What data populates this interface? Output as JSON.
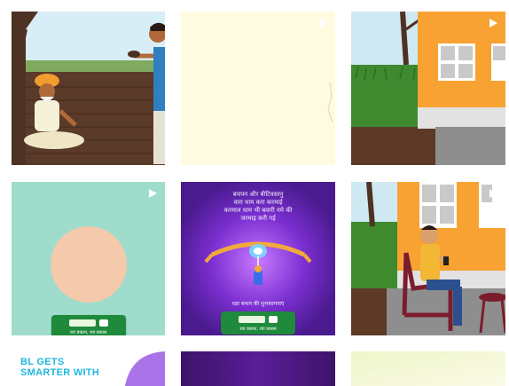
{
  "gallery": {
    "tiles": [
      {
        "id": "t1",
        "kind": "video",
        "scene": "farmer-field"
      },
      {
        "id": "t2",
        "kind": "video",
        "scene": "blank-cream"
      },
      {
        "id": "t3",
        "kind": "video",
        "scene": "orange-house"
      },
      {
        "id": "t4",
        "kind": "video",
        "scene": "peach-circle",
        "badge_caption": "रवा प्रकाश, रवा प्रकास"
      },
      {
        "id": "t5",
        "kind": "video",
        "scene": "rakhi-poster",
        "poem_lines": [
          "बचपन और बीटिवस्तनु",
          "वारा धाम करा करमाई",
          "करमाल धाम भी बवारी नमे की",
          "जरमाइ करी गई"
        ],
        "footer_text": "रक्षा बन्धन की शुभकामनाएं",
        "badge_caption": "रवा प्रकाश, रवा प्रकास"
      },
      {
        "id": "t6",
        "kind": "video",
        "scene": "man-on-chair"
      },
      {
        "id": "t7",
        "kind": "image",
        "scene": "promo",
        "promo_lines": [
          "BL GETS",
          "SMARTER WITH"
        ]
      },
      {
        "id": "t8",
        "kind": "image",
        "scene": "purple-strip"
      },
      {
        "id": "t9",
        "kind": "image",
        "scene": "cream-strip"
      }
    ]
  },
  "colors": {
    "cream": "#fffbe1",
    "mint": "#9fdccb",
    "peach": "#f4c9ac",
    "purple": "#5a1d98",
    "orange": "#f7a232",
    "badge_green": "#1f8a3c",
    "promo_cyan": "#1fb7e0"
  },
  "icons": {
    "play": "play-icon"
  }
}
